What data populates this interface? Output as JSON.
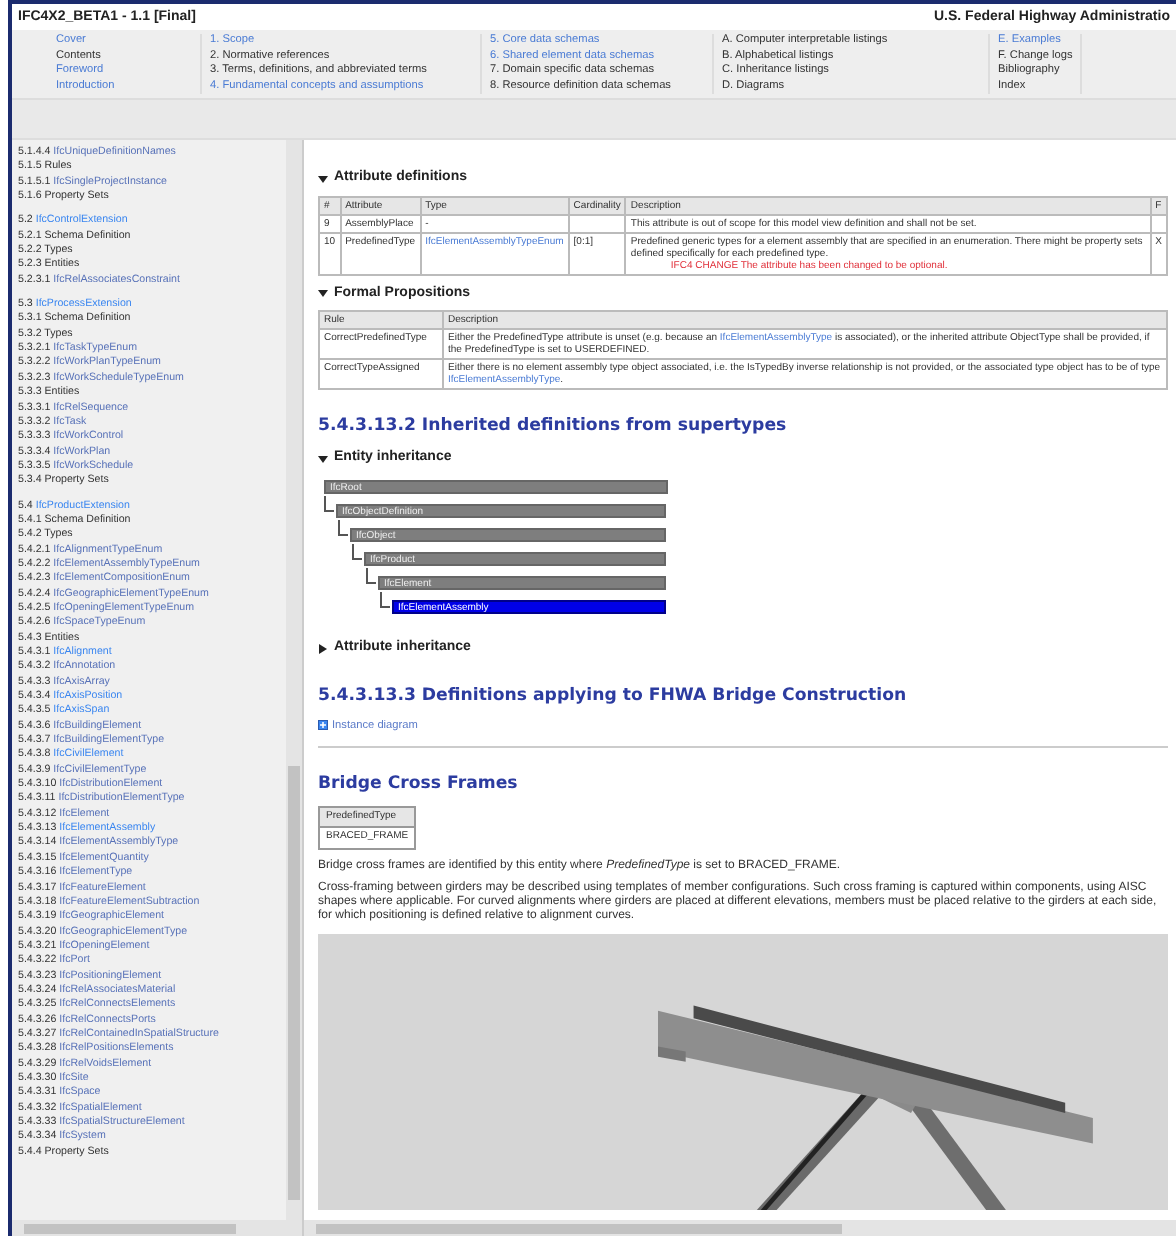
{
  "header": {
    "title": "IFC4X2_BETA1 - 1.1 [Final]",
    "agency": "U.S. Federal Highway Administratio"
  },
  "nav": {
    "columns": [
      [
        {
          "text": "Cover",
          "link": true
        },
        {
          "text": "Contents",
          "link": false
        },
        {
          "text": "Foreword",
          "link": true
        },
        {
          "text": "Introduction",
          "link": true
        }
      ],
      [
        {
          "text": "1. Scope",
          "link": true
        },
        {
          "text": "2. Normative references",
          "link": false
        },
        {
          "text": "3. Terms, definitions, and abbreviated terms",
          "link": false
        },
        {
          "text": "4. Fundamental concepts and assumptions",
          "link": true
        }
      ],
      [
        {
          "text": "5. Core data schemas",
          "link": true
        },
        {
          "text": "6. Shared element data schemas",
          "link": true
        },
        {
          "text": "7. Domain specific data schemas",
          "link": false
        },
        {
          "text": "8. Resource definition data schemas",
          "link": false
        }
      ],
      [
        {
          "text": "A. Computer interpretable listings",
          "link": false
        },
        {
          "text": "B. Alphabetical listings",
          "link": false
        },
        {
          "text": "C. Inheritance listings",
          "link": false
        },
        {
          "text": "D. Diagrams",
          "link": false
        }
      ],
      [
        {
          "text": "E. Examples",
          "link": true
        },
        {
          "text": "F. Change logs",
          "link": false
        },
        {
          "text": "Bibliography",
          "link": false
        },
        {
          "text": "Index",
          "link": false
        }
      ]
    ]
  },
  "sidebar": {
    "groups": [
      [
        {
          "number": "5.1.4.4",
          "name": "IfcUniqueDefinitionNames",
          "kind": "link"
        },
        {
          "number": "5.1.5",
          "name": "Rules",
          "kind": "plain"
        },
        {
          "number": "5.1.5.1",
          "name": "IfcSingleProjectInstance",
          "kind": "link"
        },
        {
          "number": "5.1.6",
          "name": "Property Sets",
          "kind": "plain"
        }
      ],
      [
        {
          "number": "5.2",
          "name": "IfcControlExtension",
          "kind": "highlight"
        },
        {
          "number": "5.2.1",
          "name": "Schema Definition",
          "kind": "plain"
        },
        {
          "number": "5.2.2",
          "name": "Types",
          "kind": "plain"
        },
        {
          "number": "5.2.3",
          "name": "Entities",
          "kind": "plain"
        },
        {
          "number": "5.2.3.1",
          "name": "IfcRelAssociatesConstraint",
          "kind": "link"
        }
      ],
      [
        {
          "number": "5.3",
          "name": "IfcProcessExtension",
          "kind": "highlight"
        },
        {
          "number": "5.3.1",
          "name": "Schema Definition",
          "kind": "plain"
        },
        {
          "number": "5.3.2",
          "name": "Types",
          "kind": "plain"
        },
        {
          "number": "5.3.2.1",
          "name": "IfcTaskTypeEnum",
          "kind": "link"
        },
        {
          "number": "5.3.2.2",
          "name": "IfcWorkPlanTypeEnum",
          "kind": "link"
        },
        {
          "number": "5.3.2.3",
          "name": "IfcWorkScheduleTypeEnum",
          "kind": "link"
        },
        {
          "number": "5.3.3",
          "name": "Entities",
          "kind": "plain"
        },
        {
          "number": "5.3.3.1",
          "name": "IfcRelSequence",
          "kind": "link"
        },
        {
          "number": "5.3.3.2",
          "name": "IfcTask",
          "kind": "link"
        },
        {
          "number": "5.3.3.3",
          "name": "IfcWorkControl",
          "kind": "link"
        },
        {
          "number": "5.3.3.4",
          "name": "IfcWorkPlan",
          "kind": "link"
        },
        {
          "number": "5.3.3.5",
          "name": "IfcWorkSchedule",
          "kind": "link"
        },
        {
          "number": "5.3.4",
          "name": "Property Sets",
          "kind": "plain"
        }
      ],
      [
        {
          "number": "5.4",
          "name": "IfcProductExtension",
          "kind": "highlight"
        },
        {
          "number": "5.4.1",
          "name": "Schema Definition",
          "kind": "plain"
        },
        {
          "number": "5.4.2",
          "name": "Types",
          "kind": "plain"
        },
        {
          "number": "5.4.2.1",
          "name": "IfcAlignmentTypeEnum",
          "kind": "link"
        },
        {
          "number": "5.4.2.2",
          "name": "IfcElementAssemblyTypeEnum",
          "kind": "link"
        },
        {
          "number": "5.4.2.3",
          "name": "IfcElementCompositionEnum",
          "kind": "link"
        },
        {
          "number": "5.4.2.4",
          "name": "IfcGeographicElementTypeEnum",
          "kind": "link"
        },
        {
          "number": "5.4.2.5",
          "name": "IfcOpeningElementTypeEnum",
          "kind": "link"
        },
        {
          "number": "5.4.2.6",
          "name": "IfcSpaceTypeEnum",
          "kind": "link"
        },
        {
          "number": "5.4.3",
          "name": "Entities",
          "kind": "plain"
        },
        {
          "number": "5.4.3.1",
          "name": "IfcAlignment",
          "kind": "highlight"
        },
        {
          "number": "5.4.3.2",
          "name": "IfcAnnotation",
          "kind": "link"
        },
        {
          "number": "5.4.3.3",
          "name": "IfcAxisArray",
          "kind": "link"
        },
        {
          "number": "5.4.3.4",
          "name": "IfcAxisPosition",
          "kind": "highlight"
        },
        {
          "number": "5.4.3.5",
          "name": "IfcAxisSpan",
          "kind": "highlight"
        },
        {
          "number": "5.4.3.6",
          "name": "IfcBuildingElement",
          "kind": "link"
        },
        {
          "number": "5.4.3.7",
          "name": "IfcBuildingElementType",
          "kind": "link"
        },
        {
          "number": "5.4.3.8",
          "name": "IfcCivilElement",
          "kind": "highlight"
        },
        {
          "number": "5.4.3.9",
          "name": "IfcCivilElementType",
          "kind": "link"
        },
        {
          "number": "5.4.3.10",
          "name": "IfcDistributionElement",
          "kind": "link"
        },
        {
          "number": "5.4.3.11",
          "name": "IfcDistributionElementType",
          "kind": "link"
        },
        {
          "number": "5.4.3.12",
          "name": "IfcElement",
          "kind": "link"
        },
        {
          "number": "5.4.3.13",
          "name": "IfcElementAssembly",
          "kind": "highlight"
        },
        {
          "number": "5.4.3.14",
          "name": "IfcElementAssemblyType",
          "kind": "link"
        },
        {
          "number": "5.4.3.15",
          "name": "IfcElementQuantity",
          "kind": "link"
        },
        {
          "number": "5.4.3.16",
          "name": "IfcElementType",
          "kind": "link"
        },
        {
          "number": "5.4.3.17",
          "name": "IfcFeatureElement",
          "kind": "link"
        },
        {
          "number": "5.4.3.18",
          "name": "IfcFeatureElementSubtraction",
          "kind": "link"
        },
        {
          "number": "5.4.3.19",
          "name": "IfcGeographicElement",
          "kind": "link"
        },
        {
          "number": "5.4.3.20",
          "name": "IfcGeographicElementType",
          "kind": "link"
        },
        {
          "number": "5.4.3.21",
          "name": "IfcOpeningElement",
          "kind": "link"
        },
        {
          "number": "5.4.3.22",
          "name": "IfcPort",
          "kind": "link"
        },
        {
          "number": "5.4.3.23",
          "name": "IfcPositioningElement",
          "kind": "link"
        },
        {
          "number": "5.4.3.24",
          "name": "IfcRelAssociatesMaterial",
          "kind": "link"
        },
        {
          "number": "5.4.3.25",
          "name": "IfcRelConnectsElements",
          "kind": "link"
        },
        {
          "number": "5.4.3.26",
          "name": "IfcRelConnectsPorts",
          "kind": "link"
        },
        {
          "number": "5.4.3.27",
          "name": "IfcRelContainedInSpatialStructure",
          "kind": "link"
        },
        {
          "number": "5.4.3.28",
          "name": "IfcRelPositionsElements",
          "kind": "link"
        },
        {
          "number": "5.4.3.29",
          "name": "IfcRelVoidsElement",
          "kind": "link"
        },
        {
          "number": "5.4.3.30",
          "name": "IfcSite",
          "kind": "link"
        },
        {
          "number": "5.4.3.31",
          "name": "IfcSpace",
          "kind": "link"
        },
        {
          "number": "5.4.3.32",
          "name": "IfcSpatialElement",
          "kind": "link"
        },
        {
          "number": "5.4.3.33",
          "name": "IfcSpatialStructureElement",
          "kind": "link"
        },
        {
          "number": "5.4.3.34",
          "name": "IfcSystem",
          "kind": "link"
        },
        {
          "number": "5.4.4",
          "name": "Property Sets",
          "kind": "plain"
        }
      ]
    ]
  },
  "attribute_definitions": {
    "title": "Attribute definitions",
    "expanded": true,
    "columns": [
      "#",
      "Attribute",
      "Type",
      "Cardinality",
      "Description",
      "F"
    ],
    "rows": [
      {
        "number": "9",
        "attribute": "AssemblyPlace",
        "type": "-",
        "type_link": false,
        "cardinality": "",
        "description": "This attribute is out of scope for this model view definition and shall not be set.",
        "note": "",
        "flag": ""
      },
      {
        "number": "10",
        "attribute": "PredefinedType",
        "type": "IfcElementAssemblyTypeEnum",
        "type_link": true,
        "cardinality": "[0:1]",
        "description": "Predefined generic types for a element assembly that are specified in an enumeration. There might be property sets defined specifically for each predefined type.",
        "note": "IFC4 CHANGE  The attribute has been changed to be optional.",
        "flag": "X"
      }
    ]
  },
  "formal_propositions": {
    "title": "Formal Propositions",
    "expanded": true,
    "columns": [
      "Rule",
      "Description"
    ],
    "rows": [
      {
        "rule": "CorrectPredefinedType",
        "description": {
          "before": "Either the PredefinedType attribute is unset (e.g. because an ",
          "link": "IfcElementAssemblyType",
          "after": " is associated), or the inherited attribute ObjectType shall be provided, if the PredefinedType is set to USERDEFINED."
        }
      },
      {
        "rule": "CorrectTypeAssigned",
        "description": {
          "before": "Either there is no element assembly type object associated, i.e. the IsTypedBy inverse relationship is not provided, or the associated type object has to be of type ",
          "link": "IfcElementAssemblyType",
          "after": "."
        }
      }
    ]
  },
  "inherited": {
    "heading": "5.4.3.13.2   Inherited definitions from supertypes",
    "entity_inheritance": {
      "title": "Entity inheritance",
      "expanded": true,
      "tree": [
        {
          "label": "IfcRoot",
          "selected": false,
          "children": [
            {
              "label": "IfcObjectDefinition",
              "selected": false,
              "children": [
                {
                  "label": "IfcObject",
                  "selected": false,
                  "children": [
                    {
                      "label": "IfcProduct",
                      "selected": false,
                      "children": [
                        {
                          "label": "IfcElement",
                          "selected": false,
                          "children": [
                            {
                              "label": "IfcElementAssembly",
                              "selected": true
                            }
                          ]
                        }
                      ]
                    }
                  ]
                }
              ]
            }
          ]
        }
      ]
    },
    "attribute_inheritance": {
      "title": "Attribute inheritance",
      "expanded": false
    }
  },
  "fhwa": {
    "heading": "5.4.3.13.3   Definitions applying to FHWA Bridge Construction",
    "instance_link": "Instance diagram",
    "subsection": {
      "title": "Bridge Cross Frames",
      "table": {
        "header": "PredefinedType",
        "value": "BRACED_FRAME"
      },
      "paragraphs": [
        "Bridge cross frames are identified by this entity where *PredefinedType* is set to BRACED_FRAME.",
        "Cross-framing between girders may be described using templates of member configurations. Such cross framing is captured within components, using AISC shapes where applicable. For curved alignments where girders are placed at different elevations, members must be placed relative to the girders at each side, for which positioning is defined relative to alignment curves."
      ]
    }
  }
}
